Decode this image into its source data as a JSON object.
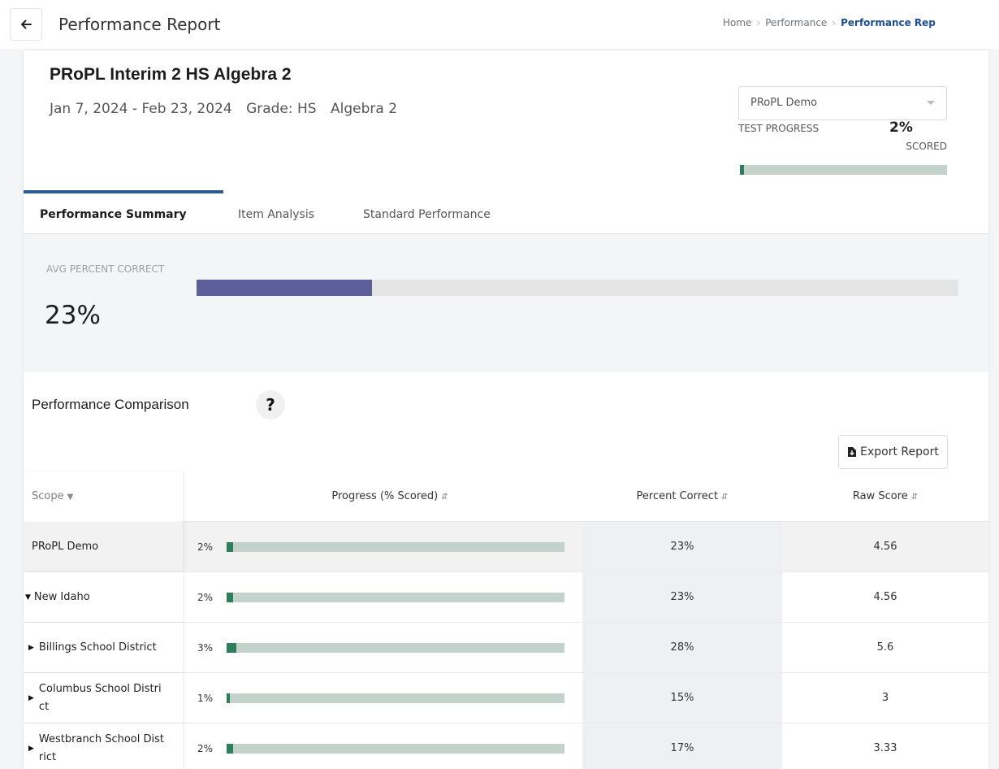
{
  "header": {
    "title": "Performance Report",
    "breadcrumb": [
      "Home",
      "Performance",
      "Performance Rep"
    ]
  },
  "assessment": {
    "title": "PRoPL Interim 2 HS Algebra 2",
    "date_range": "Jan 7, 2024 - Feb 23, 2024",
    "grade": "Grade: HS",
    "subject": "Algebra 2"
  },
  "org_select": {
    "value": "PRoPL Demo"
  },
  "test_progress": {
    "label": "TEST PROGRESS",
    "value": "2%",
    "sub_label": "SCORED",
    "fraction": 0.02
  },
  "tabs": [
    {
      "label": "Performance Summary",
      "active": true
    },
    {
      "label": "Item Analysis",
      "active": false
    },
    {
      "label": "Standard Performance",
      "active": false
    }
  ],
  "avg": {
    "label": "AVG PERCENT CORRECT",
    "value": "23%",
    "fraction": 0.23,
    "color": "#5c5f99"
  },
  "comparison": {
    "title": "Performance Comparison",
    "help_glyph": "?",
    "export_label": "Export Report",
    "columns": {
      "scope": "Scope",
      "progress": "Progress (% Scored)",
      "percent_correct": "Percent Correct",
      "raw_score": "Raw Score"
    },
    "rows": [
      {
        "scope": "PRoPL Demo",
        "indicator": "",
        "progress": "2%",
        "progress_fraction": 0.02,
        "percent_correct": "23%",
        "raw_score": "4.56"
      },
      {
        "scope": "New Idaho",
        "indicator": "down",
        "progress": "2%",
        "progress_fraction": 0.02,
        "percent_correct": "23%",
        "raw_score": "4.56"
      },
      {
        "scope": "Billings School District",
        "indicator": "right",
        "progress": "3%",
        "progress_fraction": 0.03,
        "percent_correct": "28%",
        "raw_score": "5.6"
      },
      {
        "scope": "Columbus School District",
        "indicator": "right",
        "progress": "1%",
        "progress_fraction": 0.01,
        "percent_correct": "15%",
        "raw_score": "3"
      },
      {
        "scope": "Westbranch School District",
        "indicator": "right",
        "progress": "2%",
        "progress_fraction": 0.02,
        "percent_correct": "17%",
        "raw_score": "3.33"
      }
    ]
  },
  "colors": {
    "accent": "#2a5d8f",
    "progress_fill": "#2e7d5b",
    "progress_track": "#c3d2cb"
  }
}
